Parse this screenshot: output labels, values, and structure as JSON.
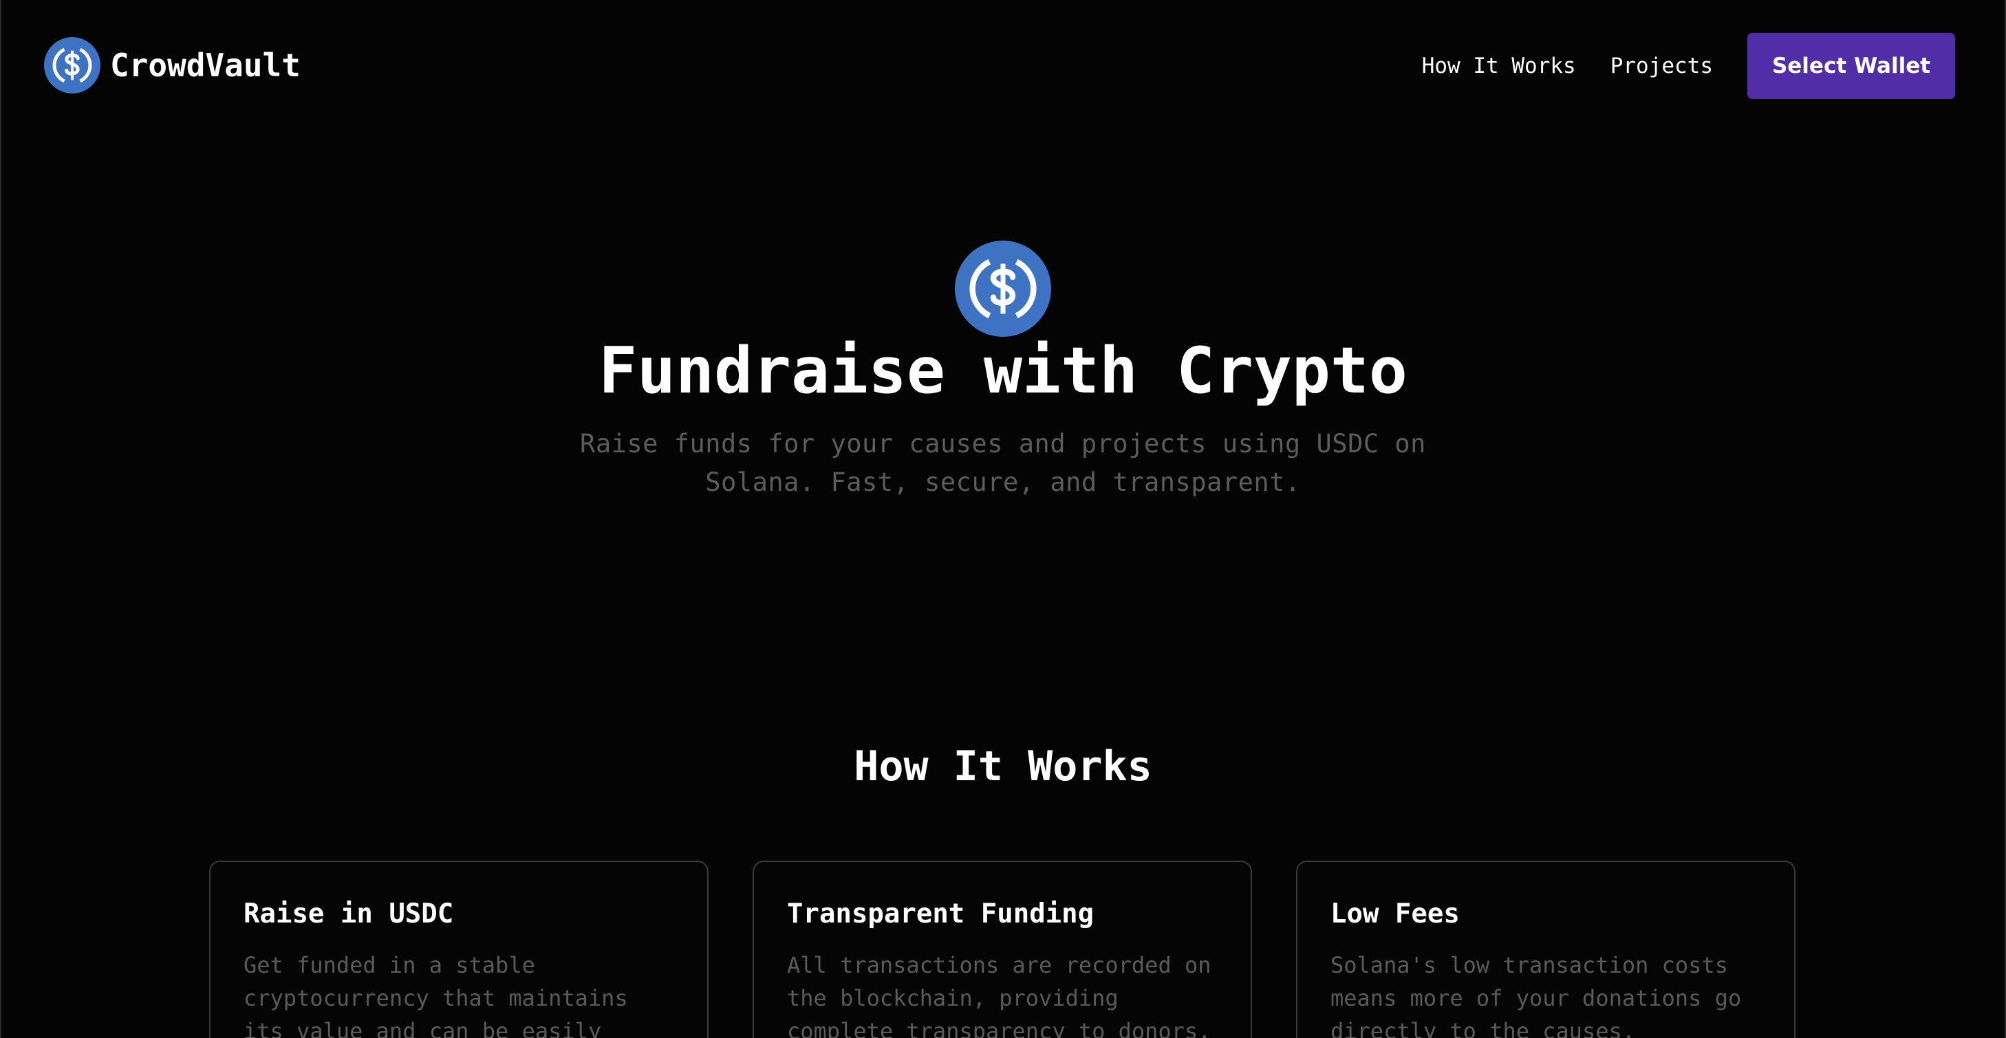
{
  "brand": {
    "name": "CrowdVault",
    "logo_icon": "usdc-coin-icon"
  },
  "nav": {
    "links": [
      "How It Works",
      "Projects"
    ],
    "wallet_button": "Select Wallet"
  },
  "hero": {
    "icon": "usdc-coin-icon",
    "title": "Fundraise with Crypto",
    "subtitle": "Raise funds for your causes and projects using USDC on Solana. Fast, secure, and transparent."
  },
  "how_it_works": {
    "title": "How It Works",
    "cards": [
      {
        "title": "Raise in USDC",
        "text": "Get funded in a stable cryptocurrency that maintains its value and can be easily"
      },
      {
        "title": "Transparent Funding",
        "text": "All transactions are recorded on the blockchain, providing complete transparency to donors."
      },
      {
        "title": "Low Fees",
        "text": "Solana's low transaction costs means more of your donations go directly to the causes."
      }
    ]
  },
  "colors": {
    "background": "#040404",
    "accent": "#512da8",
    "usdc_blue": "#3e73c4",
    "muted_text": "#5c5c5c"
  }
}
